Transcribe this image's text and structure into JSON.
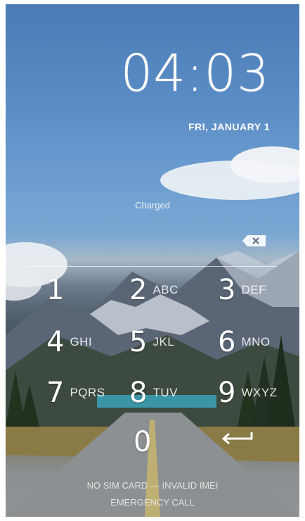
{
  "clock": {
    "time": "04:03",
    "date": "FRI, JANUARY 1"
  },
  "status": {
    "battery": "Charged"
  },
  "keypad": [
    {
      "digit": "1",
      "letters": ""
    },
    {
      "digit": "2",
      "letters": "ABC"
    },
    {
      "digit": "3",
      "letters": "DEF"
    },
    {
      "digit": "4",
      "letters": "GHI"
    },
    {
      "digit": "5",
      "letters": "JKL"
    },
    {
      "digit": "6",
      "letters": "MNO"
    },
    {
      "digit": "7",
      "letters": "PQRS"
    },
    {
      "digit": "8",
      "letters": "TUV"
    },
    {
      "digit": "9",
      "letters": "WXYZ"
    },
    {
      "digit": "0",
      "letters": ""
    }
  ],
  "footer": {
    "sim_status": "NO SIM CARD — INVALID IMEI",
    "emergency_label": "EMERGENCY CALL"
  },
  "icons": {
    "backspace": "backspace-icon",
    "enter": "enter-icon"
  },
  "colors": {
    "text": "#ffffff",
    "sky_top": "#4b7bb6"
  }
}
